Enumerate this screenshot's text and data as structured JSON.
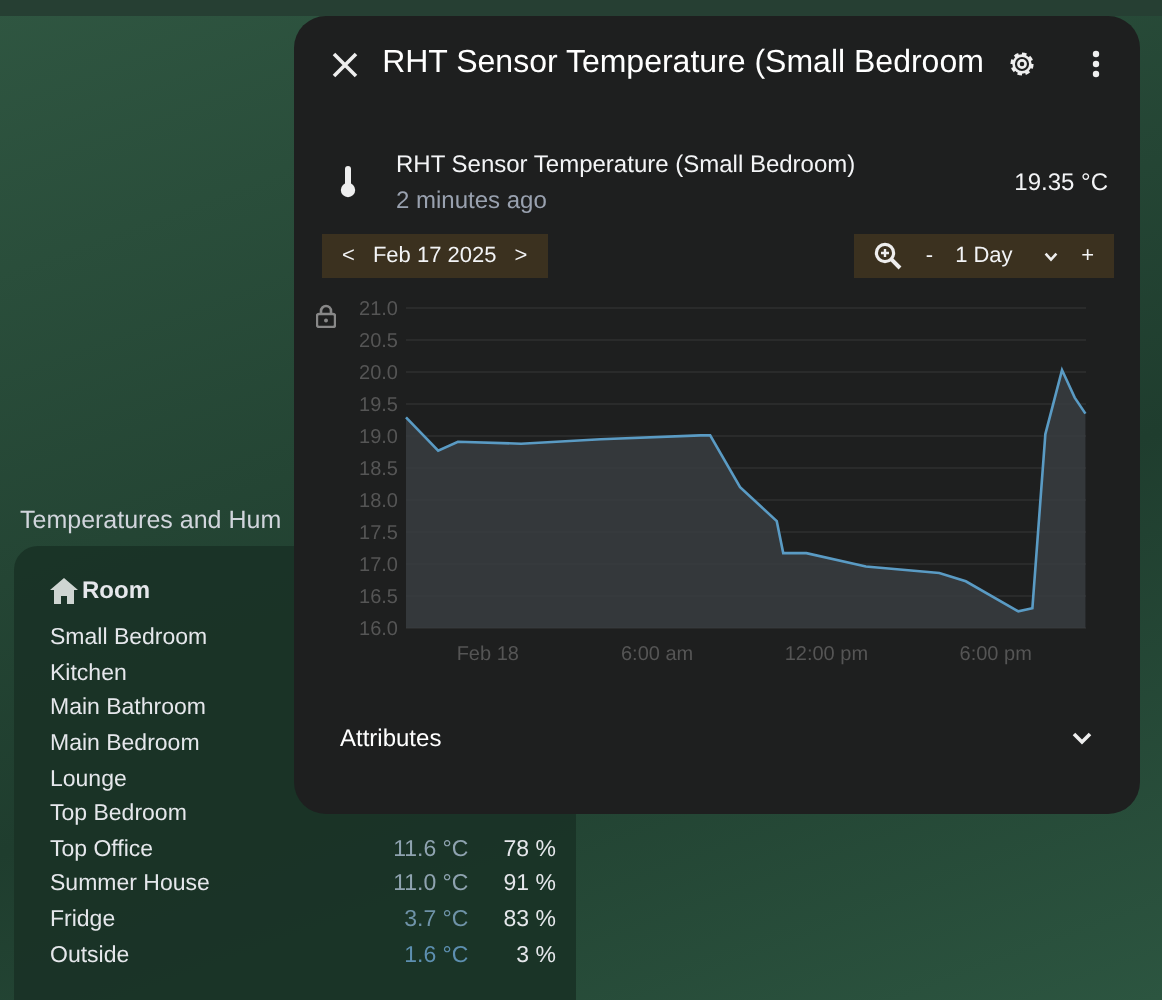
{
  "section_title": "Temperatures and Hum",
  "room_card": {
    "header": "Room",
    "rows": [
      {
        "room": "Small Bedroom"
      },
      {
        "room": "Kitchen"
      },
      {
        "room": "Main Bathroom"
      },
      {
        "room": "Main Bedroom"
      },
      {
        "room": "Lounge"
      },
      {
        "room": "Top Bedroom"
      },
      {
        "room": "Top Office",
        "temperature": "11.6 °C",
        "humidity": "78 %",
        "color": "#8fa3b0"
      },
      {
        "room": "Summer House",
        "temperature": "11.0 °C",
        "humidity": "91 %",
        "color": "#8fa3b0"
      },
      {
        "room": "Fridge",
        "temperature": "3.7 °C",
        "humidity": "83 %",
        "color": "#6f93a8"
      },
      {
        "room": "Outside",
        "temperature": "1.6 °C",
        "humidity": "3 %",
        "color": "#5d8fb0"
      }
    ]
  },
  "dialog": {
    "title": "RHT Sensor Temperature (Small Bedroom",
    "entity": {
      "name": "RHT Sensor Temperature (Small Bedroom)",
      "updated": "2 minutes ago",
      "state": "19.35 °C"
    },
    "date_nav": {
      "prev": "<",
      "date": "Feb 17 2025",
      "next": ">"
    },
    "range": {
      "minus": "-",
      "span": "1 Day",
      "plus": "+"
    },
    "chart_data": {
      "type": "area",
      "grid": true,
      "xlim": [
        -2.9,
        21.2
      ],
      "ylim": [
        16,
        21
      ],
      "yticks": [
        {
          "value": 16,
          "label": "16.0"
        },
        {
          "value": 16.5,
          "label": "16.5"
        },
        {
          "value": 17,
          "label": "17.0"
        },
        {
          "value": 17.5,
          "label": "17.5"
        },
        {
          "value": 18,
          "label": "18.0"
        },
        {
          "value": 18.5,
          "label": "18.5"
        },
        {
          "value": 19,
          "label": "19.0"
        },
        {
          "value": 19.5,
          "label": "19.5"
        },
        {
          "value": 20,
          "label": "20.0"
        },
        {
          "value": 20.5,
          "label": "20.5"
        },
        {
          "value": 21,
          "label": "21.0"
        }
      ],
      "xticks": [
        {
          "value": 0,
          "label": "Feb 18"
        },
        {
          "value": 6,
          "label": "6:00 am"
        },
        {
          "value": 12,
          "label": "12:00 pm"
        },
        {
          "value": 18,
          "label": "6:00 pm"
        }
      ],
      "x": [
        -2.9,
        -1.76,
        -1.06,
        1.18,
        4.0,
        7.53,
        7.88,
        8.94,
        10.24,
        10.47,
        11.29,
        13.4,
        16.0,
        16.94,
        18.8,
        19.3,
        19.76,
        20.35,
        20.8,
        21.18
      ],
      "series": [
        {
          "color": "#5a9bc4",
          "values": [
            19.29,
            18.77,
            18.91,
            18.88,
            18.95,
            19.01,
            19.01,
            18.2,
            17.67,
            17.17,
            17.17,
            16.96,
            16.86,
            16.73,
            16.26,
            16.31,
            19.03,
            20.03,
            19.6,
            19.35
          ]
        }
      ]
    },
    "attributes": {
      "label": "Attributes",
      "expanded": false
    }
  }
}
